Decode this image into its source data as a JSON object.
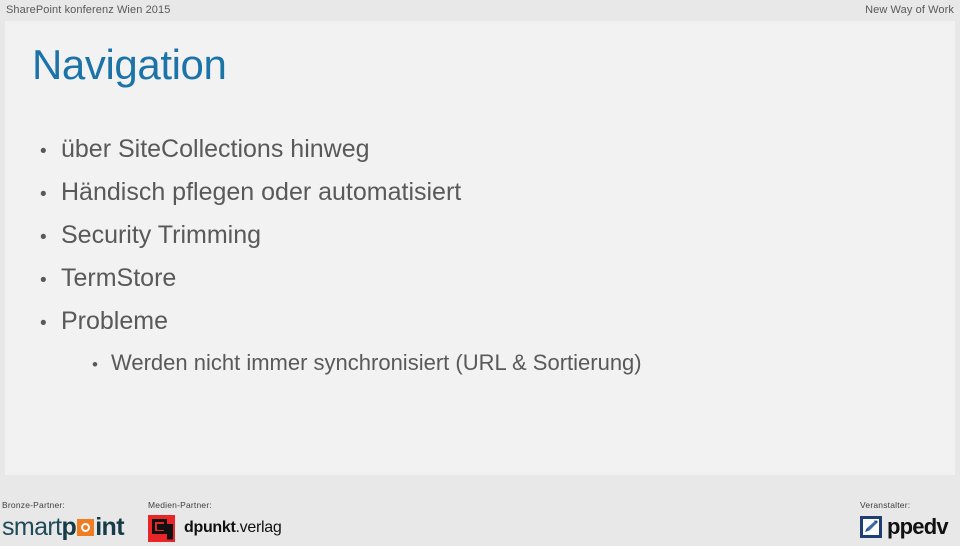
{
  "header": {
    "left_text": "SharePoint konferenz Wien 2015",
    "right_text": "New Way of Work"
  },
  "slide": {
    "title": "Navigation",
    "title_color": "#1b73a8",
    "body_color": "#595959",
    "background": "#f2f2f2",
    "bullets": [
      {
        "level": 1,
        "text": "über SiteCollections hinweg",
        "marker": "•"
      },
      {
        "level": 1,
        "text": "Händisch pflegen oder automatisiert",
        "marker": "•"
      },
      {
        "level": 1,
        "text": "Security Trimming",
        "marker": "•"
      },
      {
        "level": 1,
        "text": "TermStore",
        "marker": "•"
      },
      {
        "level": 1,
        "text": "Probleme",
        "marker": "•"
      },
      {
        "level": 2,
        "text": "Werden nicht immer synchronisiert (URL & Sortierung)",
        "marker": "•"
      }
    ]
  },
  "footer": {
    "background": "#e8e8e8",
    "bronze": {
      "label": "Bronze-Partner:",
      "logo_name": "smartpoint-logo",
      "logo_parts": {
        "part1": "smart",
        "part2": "p",
        "part3": "int"
      },
      "accent_color": "#ef7d22",
      "text_color": "#1f4a57"
    },
    "medien": {
      "label": "Medien-Partner:",
      "logo_name": "dpunkt-verlag-logo",
      "logo_text_bold": "dpunkt",
      "logo_text_rest": ".verlag",
      "mark_color": "#e8262a"
    },
    "veranstalter": {
      "label": "Veranstalter:",
      "logo_name": "ppedv-logo",
      "logo_text": "ppedv",
      "mark_color": "#1d3f72"
    }
  }
}
